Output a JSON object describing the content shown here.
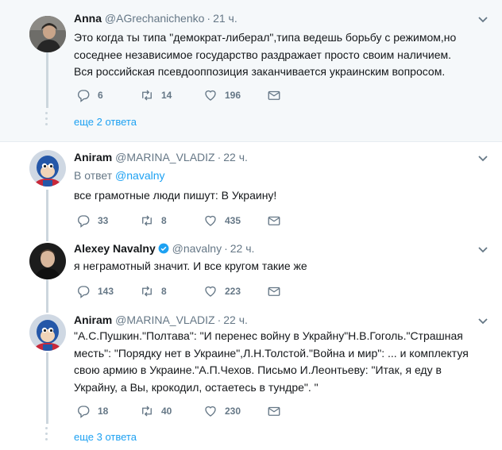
{
  "tweets": [
    {
      "name": "Anna",
      "handle": "@AGrechanichenko",
      "time": "21 ч.",
      "text": "Это когда ты типа \"демократ-либерал\",типа ведешь борьбу с режимом,но соседнее независимое государство раздражает  просто своим наличием. Вся российская псевдооппозиция заканчивается украинским вопросом.",
      "replies": "6",
      "retweets": "14",
      "likes": "196",
      "more_replies": "еще 2 ответа"
    },
    {
      "name": "Aniram",
      "handle": "@MARINA_VLADIZ",
      "time": "22 ч.",
      "reply_prefix": "В ответ",
      "reply_to": "@navalny",
      "text": "все грамотные люди пишут:  В Украину!",
      "replies": "33",
      "retweets": "8",
      "likes": "435"
    },
    {
      "name": "Alexey Navalny",
      "handle": "@navalny",
      "time": "22 ч.",
      "text": "я неграмотный значит. И все кругом такие же",
      "replies": "143",
      "retweets": "8",
      "likes": "223"
    },
    {
      "name": "Aniram",
      "handle": "@MARINA_VLADIZ",
      "time": "22 ч.",
      "text": "\"А.С.Пушкин.\"Полтава\": \"И перенес войну в Украйну\"Н.В.Гоголь.\"Страшная месть\": \"Порядку нет в Украине\",Л.Н.Толстой.\"Война и мир\": ... и комплектуя свою армию в Украине.\"А.П.Чехов. Письмо И.Леонтьеву: \"Итак, я еду в Украйну, а Вы, крокодил, остаетесь в тундре\". \"",
      "replies": "18",
      "retweets": "40",
      "likes": "230",
      "more_replies": "еще 3 ответа"
    }
  ],
  "colors": {
    "accent": "#1da1f2",
    "muted": "#657786",
    "verified": "#1da1f2",
    "highlight_bg": "#f5f8fa"
  },
  "icons": [
    "reply-icon",
    "retweet-icon",
    "like-icon",
    "direct-message-icon",
    "chevron-down-icon",
    "verified-badge-icon"
  ]
}
